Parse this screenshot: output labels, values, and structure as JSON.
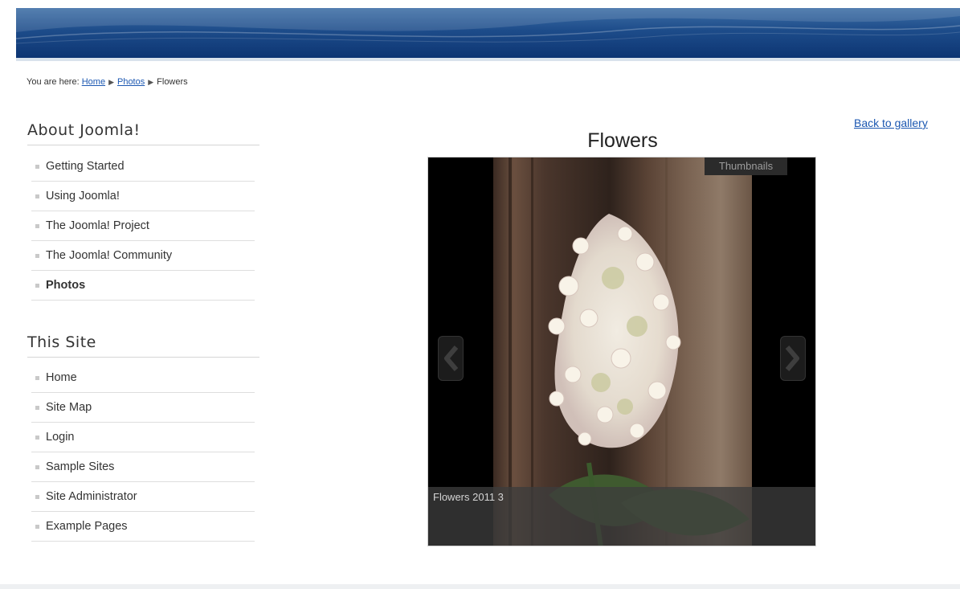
{
  "breadcrumb": {
    "prefix": "You are here:",
    "items": [
      "Home",
      "Photos"
    ],
    "current": "Flowers"
  },
  "about_module": {
    "title": "About Joomla!",
    "items": [
      {
        "label": "Getting Started"
      },
      {
        "label": "Using Joomla!"
      },
      {
        "label": "The Joomla! Project"
      },
      {
        "label": "The Joomla! Community"
      },
      {
        "label": "Photos",
        "active": true
      }
    ]
  },
  "site_module": {
    "title": "This Site",
    "items": [
      {
        "label": "Home"
      },
      {
        "label": "Site Map"
      },
      {
        "label": "Login"
      },
      {
        "label": "Sample Sites"
      },
      {
        "label": "Site Administrator"
      },
      {
        "label": "Example Pages"
      }
    ]
  },
  "gallery": {
    "title": "Flowers",
    "back_label": "Back to gallery",
    "thumbnails_label": "Thumbnails",
    "caption": "Flowers 2011 3"
  },
  "icons": {
    "prev": "arrow-left-icon",
    "next": "arrow-right-icon",
    "bullet": "square-bullet-icon"
  },
  "colors": {
    "link": "#1b57b1",
    "header": "#1d4c8a"
  }
}
